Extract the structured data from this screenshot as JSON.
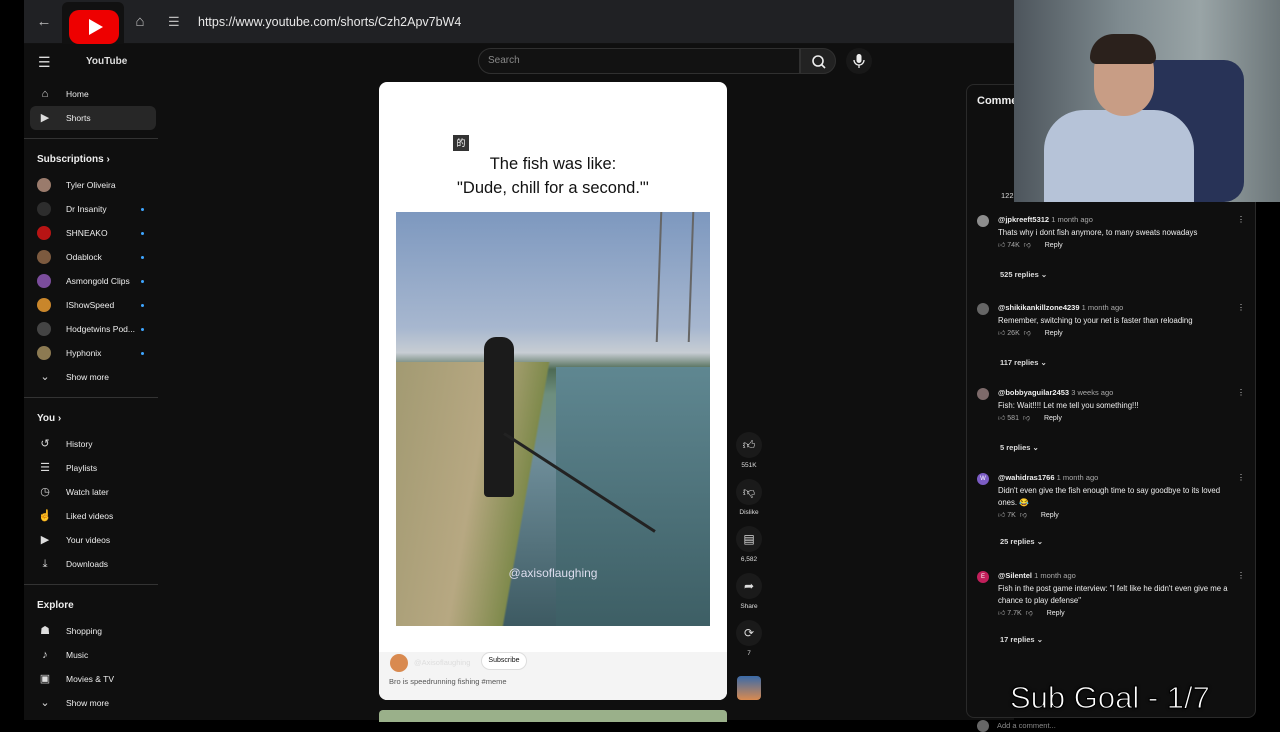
{
  "browser": {
    "url": "https://www.youtube.com/shorts/Czh2Apv7bW4"
  },
  "masthead": {
    "logo_text": "YouTube",
    "search_placeholder": "Search"
  },
  "sidebar": {
    "main": [
      {
        "label": "Home",
        "icon": "home-icon"
      },
      {
        "label": "Shorts",
        "icon": "shorts-icon",
        "active": true
      }
    ],
    "subscriptions_title": "Subscriptions",
    "subscriptions": [
      {
        "label": "Tyler Oliveira",
        "color": "#9a7b6c",
        "live": false
      },
      {
        "label": "Dr Insanity",
        "color": "#2d2d2d",
        "live": true
      },
      {
        "label": "SHNEAKO",
        "color": "#b81414",
        "live": true
      },
      {
        "label": "Odablock",
        "color": "#7c5a3f",
        "live": true
      },
      {
        "label": "Asmongold Clips",
        "color": "#7b4d9c",
        "live": true
      },
      {
        "label": "IShowSpeed",
        "color": "#c9862b",
        "live": true
      },
      {
        "label": "Hodgetwins Pod...",
        "color": "#444444",
        "live": true
      },
      {
        "label": "Hyphonix",
        "color": "#8c7a52",
        "live": true
      }
    ],
    "show_more": "Show more",
    "you_title": "You",
    "you_items": [
      {
        "label": "History",
        "icon": "history-icon"
      },
      {
        "label": "Playlists",
        "icon": "playlists-icon"
      },
      {
        "label": "Watch later",
        "icon": "watch-later-icon"
      },
      {
        "label": "Liked videos",
        "icon": "liked-icon"
      },
      {
        "label": "Your videos",
        "icon": "your-videos-icon"
      },
      {
        "label": "Downloads",
        "icon": "downloads-icon"
      }
    ],
    "explore_title": "Explore",
    "explore_items": [
      {
        "label": "Shopping",
        "icon": "shopping-icon"
      },
      {
        "label": "Music",
        "icon": "music-icon"
      },
      {
        "label": "Movies & TV",
        "icon": "movies-icon"
      }
    ],
    "show_more_2": "Show more"
  },
  "short": {
    "caption_line1": "The fish was like:",
    "caption_line2": "\"Dude, chill for a second.\"'",
    "watermark": "@axisoflaughing",
    "channel": "@Axisoflaughing",
    "subscribe": "Subscribe",
    "description": "Bro is speedrunning fishing #meme"
  },
  "actions": {
    "like_count": "551K",
    "dislike_label": "Dislike",
    "comment_count": "6,582",
    "share_label": "Share",
    "remix_count": "7"
  },
  "comments": {
    "title": "Comme",
    "first_reply_count": "122",
    "items": [
      {
        "user": "@jpkreeft5312",
        "time": "1 month ago",
        "text": "Thats why i dont fish anymore, to many sweats nowadays",
        "likes": "74K",
        "replies": "525 replies",
        "avatar_color": "#8d8d8d",
        "avatar_letter": ""
      },
      {
        "user": "@shikikankillzone4239",
        "time": "1 month ago",
        "text": "Remember, switching to your net is faster than reloading",
        "likes": "26K",
        "replies": "117 replies",
        "avatar_color": "#666666",
        "avatar_letter": ""
      },
      {
        "user": "@bobbyaguilar2453",
        "time": "3 weeks ago",
        "text": "Fish: Wait!!!! Let me tell you something!!!",
        "likes": "581",
        "replies": "5 replies",
        "avatar_color": "#7d6a6a",
        "avatar_letter": ""
      },
      {
        "user": "@wahidras1766",
        "time": "1 month ago",
        "text": "Didn't even give the fish enough time to say goodbye to its loved ones. 😂",
        "likes": "7K",
        "replies": "25 replies",
        "avatar_color": "#7b5cc4",
        "avatar_letter": "W"
      },
      {
        "user": "@Silentel",
        "time": "1 month ago",
        "text": "Fish in the post game interview: \"I felt like he didn't even give me a chance to play defense\"",
        "likes": "7.7K",
        "replies": "17 replies",
        "avatar_color": "#c21f5b",
        "avatar_letter": "E"
      }
    ],
    "reply_label": "Reply",
    "add_placeholder": "Add a comment..."
  },
  "overlay": {
    "sub_goal": "Sub Goal - 1/7"
  }
}
